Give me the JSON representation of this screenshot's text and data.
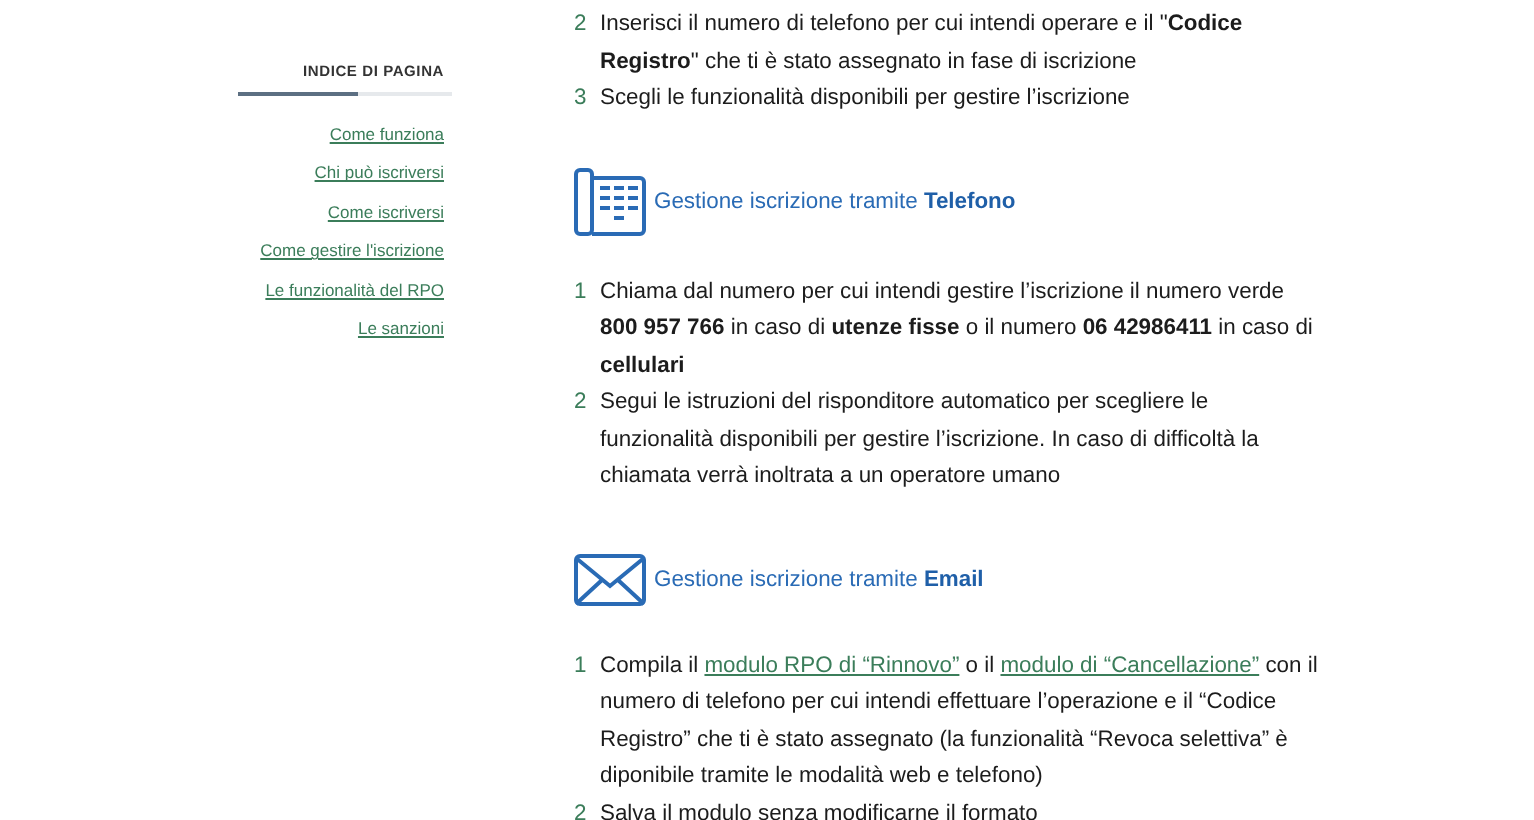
{
  "sidebar": {
    "title": "INDICE DI PAGINA",
    "links": [
      "Come funziona",
      "Chi può iscriversi",
      "Come iscriversi",
      "Come gestire l'iscrizione",
      "Le funzionalità del RPO",
      "Le sanzioni"
    ]
  },
  "sections": [
    {
      "kind": "intro",
      "steps": [
        {
          "number": "2",
          "parts": [
            {
              "kind": "text",
              "text": "Inserisci il numero di telefono per cui intendi operare e il \"**Codice Registro**\" che ti è stato assegnato in fase di iscrizione"
            }
          ]
        },
        {
          "number": "3",
          "parts": [
            {
              "kind": "text",
              "text": "Scegli le funzionalità disponibili per gestire l’iscrizione"
            }
          ]
        }
      ]
    },
    {
      "kind": "phone",
      "heading": "Gestione iscrizione tramite **Telefono**",
      "steps": [
        {
          "number": "1",
          "parts": [
            {
              "kind": "text",
              "text": "Chiama dal numero per cui intendi gestire l’iscrizione il numero verde **800 957 766** in caso di **utenze fisse** o il numero **06 42986411** in caso di **cellulari**"
            }
          ]
        },
        {
          "number": "2",
          "parts": [
            {
              "kind": "text",
              "text": "Segui le istruzioni del risponditore automatico per scegliere le funzionalità disponibili per gestire l’iscrizione. In caso di difficoltà la chiamata verrà inoltrata a un operatore umano"
            }
          ]
        }
      ]
    },
    {
      "kind": "email",
      "heading": "Gestione iscrizione tramite **Email**",
      "steps": [
        {
          "number": "1",
          "parts": [
            {
              "kind": "text",
              "text": "Compila il "
            },
            {
              "kind": "link",
              "text": "modulo RPO di “Rinnovo”"
            },
            {
              "kind": "text",
              "text": " o il "
            },
            {
              "kind": "link",
              "text": "modulo di “Cancellazione”"
            },
            {
              "kind": "text",
              "text": " con il numero di telefono per cui intendi effettuare l’operazione e il “Codice Registro” che ti è stato assegnato (la funzionalità “Revoca selettiva” è diponibile tramite le modalità web e telefono)"
            }
          ]
        },
        {
          "number": "2",
          "parts": [
            {
              "kind": "text",
              "text": "Salva il modulo senza modificarne il formato"
            }
          ]
        }
      ]
    }
  ]
}
